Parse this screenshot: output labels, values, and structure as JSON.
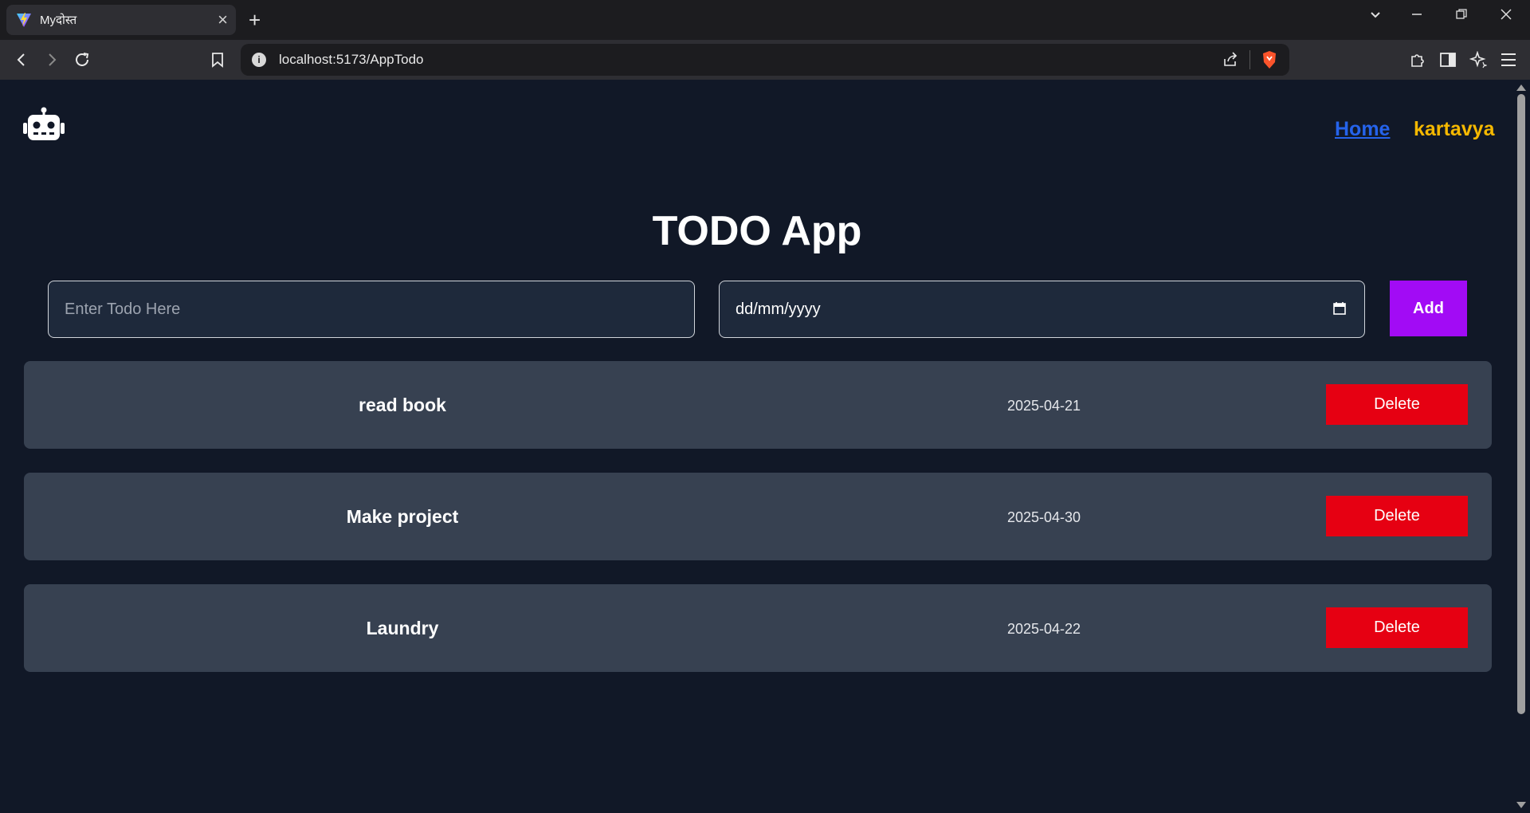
{
  "browser": {
    "tab_title": "Myदोस्त",
    "url": "localhost:5173/AppTodo"
  },
  "header": {
    "nav_home": "Home",
    "nav_user": "kartavya"
  },
  "main": {
    "title": "TODO App",
    "todo_placeholder": "Enter Todo Here",
    "date_placeholder": "dd/mm/yyyy",
    "add_label": "Add"
  },
  "todos": [
    {
      "name": "read book",
      "date": "2025-04-21",
      "delete_label": "Delete"
    },
    {
      "name": "Make project",
      "date": "2025-04-30",
      "delete_label": "Delete"
    },
    {
      "name": "Laundry",
      "date": "2025-04-22",
      "delete_label": "Delete"
    }
  ],
  "colors": {
    "page_bg": "#111827",
    "row_bg": "#374151",
    "add_button": "#a20bf5",
    "delete_button": "#e60012",
    "home_link": "#2563eb",
    "user_link": "#f5b800"
  }
}
